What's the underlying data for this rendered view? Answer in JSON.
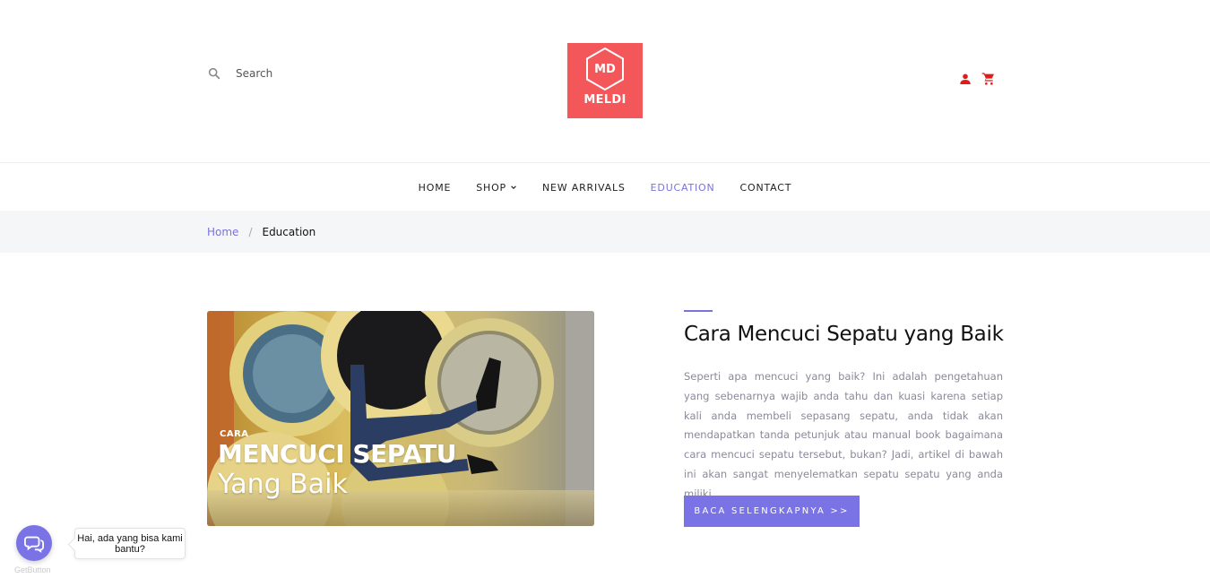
{
  "header": {
    "search_placeholder": "Search",
    "logo": {
      "initials": "MD",
      "name": "MELDI",
      "color": "#f4575a"
    },
    "icons": [
      "search-icon",
      "user-icon",
      "cart-icon"
    ],
    "icon_color": "#e01b1b"
  },
  "nav": {
    "items": [
      {
        "label": "HOME",
        "active": false
      },
      {
        "label": "SHOP",
        "active": false,
        "has_dropdown": true
      },
      {
        "label": "NEW ARRIVALS",
        "active": false
      },
      {
        "label": "EDUCATION",
        "active": true
      },
      {
        "label": "CONTACT",
        "active": false
      }
    ],
    "active_color": "#7a73d9"
  },
  "breadcrumb": {
    "home": "Home",
    "separator": "/",
    "current": "Education"
  },
  "article": {
    "image": {
      "caption_small": "CARA",
      "caption_big": "MENCUCI SEPATU",
      "caption_sub": "Yang Baik"
    },
    "title": "Cara Mencuci Sepatu yang Baik",
    "body": "Seperti apa mencuci yang baik? Ini adalah pengetahuan yang sebenarnya wajib anda tahu dan kuasi karena setiap kali anda membeli sepasang sepatu, anda tidak akan mendapatkan tanda petunjuk atau manual book bagaimana cara mencuci sepatu tersebut, bukan? Jadi, artikel di bawah ini akan sangat menyelematkan sepatu sepatu yang anda miliki.",
    "button_label": "BACA SELENGKAPNYA >>",
    "accent_color": "#7a73e6"
  },
  "chat_widget": {
    "message": "Hai, ada yang bisa kami bantu?",
    "brand": "GetButton"
  }
}
